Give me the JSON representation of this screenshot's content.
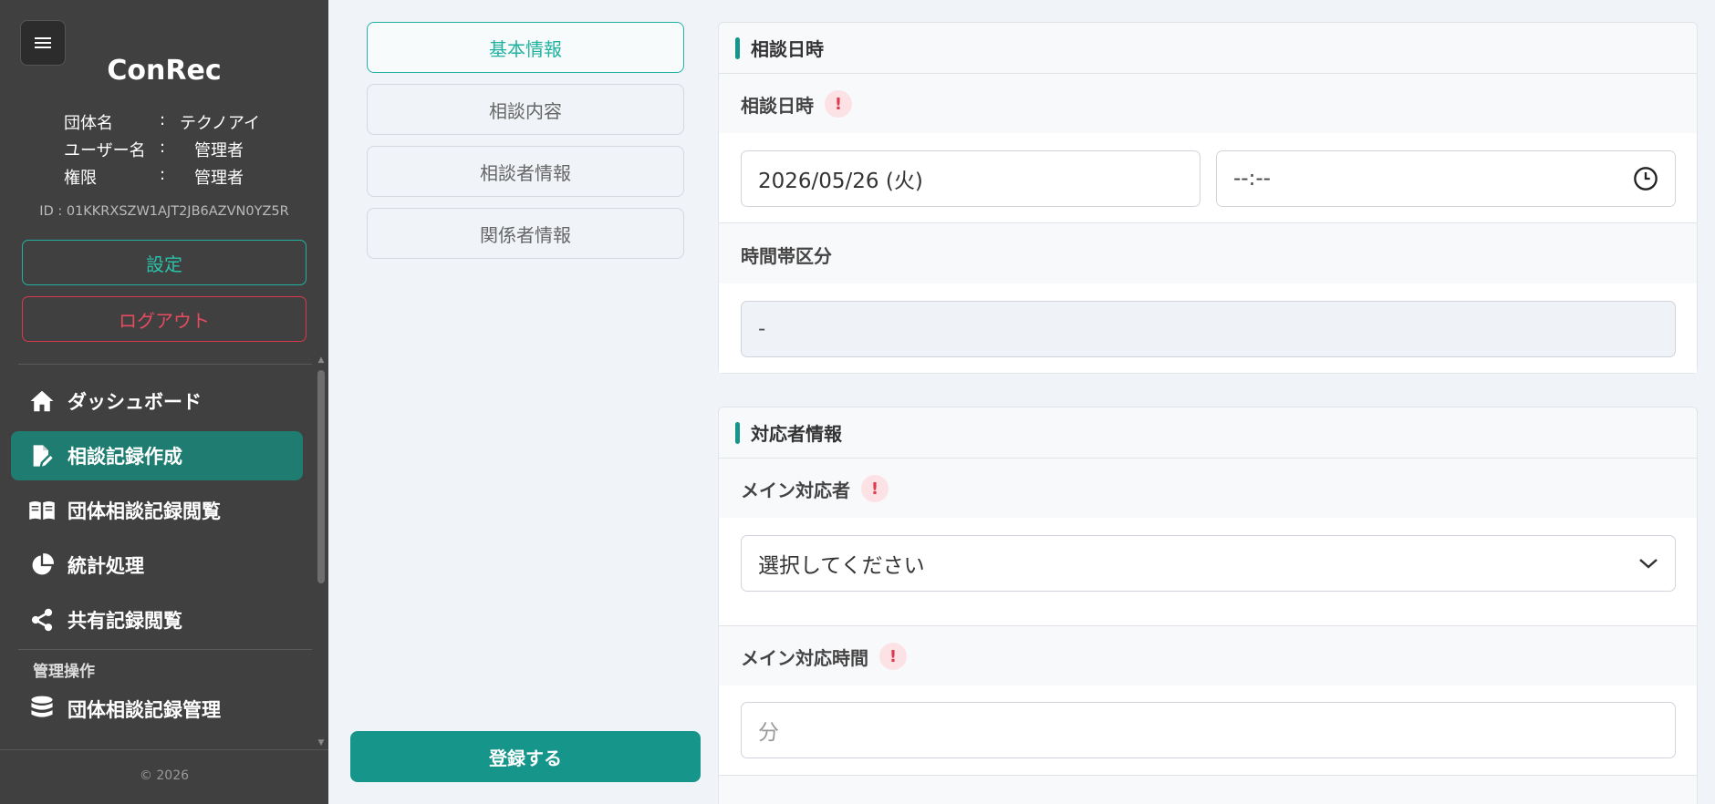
{
  "sidebar": {
    "app_title": "ConRec",
    "org_label": "団体名",
    "org_value": "テクノアイ",
    "user_label": "ユーザー名",
    "user_value": "管理者",
    "role_label": "権限",
    "role_value": "管理者",
    "colon": ":",
    "user_id": "ID : 01KKRXSZW1AJT2JB6AZVN0YZ5R",
    "settings_label": "設定",
    "logout_label": "ログアウト",
    "nav": [
      {
        "label": "ダッシュボード",
        "icon": "home-icon"
      },
      {
        "label": "相談記録作成",
        "icon": "file-edit-icon"
      },
      {
        "label": "団体相談記録閲覧",
        "icon": "book-open-icon"
      },
      {
        "label": "統計処理",
        "icon": "pie-chart-icon"
      },
      {
        "label": "共有記録閲覧",
        "icon": "share-icon"
      }
    ],
    "section_label": "管理操作",
    "admin_nav": [
      {
        "label": "団体相談記録管理",
        "icon": "database-icon"
      }
    ],
    "copyright": "© 2026"
  },
  "tabs": [
    {
      "label": "基本情報",
      "active": true
    },
    {
      "label": "相談内容",
      "active": false
    },
    {
      "label": "相談者情報",
      "active": false
    },
    {
      "label": "関係者情報",
      "active": false
    }
  ],
  "submit_label": "登録する",
  "consult_card": {
    "title": "相談日時",
    "datetime_label": "相談日時",
    "date_value": "2026/05/26 (火)",
    "time_value": "--:--",
    "timeslot_label": "時間帯区分",
    "timeslot_value": "-"
  },
  "responder_card": {
    "title": "対応者情報",
    "main_label": "メイン対応者",
    "main_select": "選択してください",
    "time_label": "メイン対応時間",
    "time_placeholder": "分"
  },
  "required_mark": "!",
  "colors": {
    "accent": "#16958a",
    "sidebar_bg": "#404040",
    "danger": "#e84a5f"
  }
}
